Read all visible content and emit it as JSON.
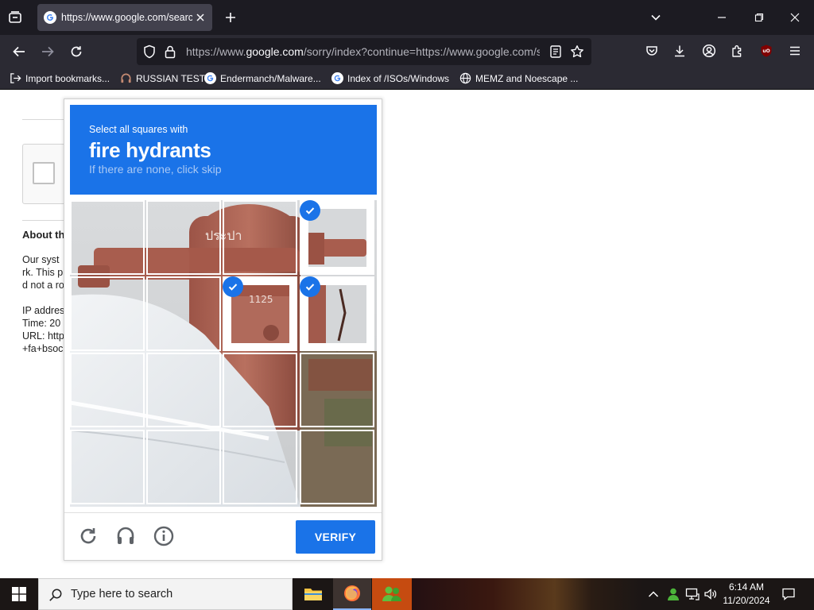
{
  "browser": {
    "tab": {
      "title": "https://www.google.com/search"
    },
    "url": {
      "prefix": "https://www.",
      "host": "google.com",
      "rest": "/sorry/index?continue=https://www.google.com/search"
    },
    "bookmarks": [
      {
        "label": "Import bookmarks...",
        "icon": "import-icon"
      },
      {
        "label": "RUSSIAN TEST",
        "icon": "headset-icon"
      },
      {
        "label": "Endermanch/Malware...",
        "icon": "google-icon"
      },
      {
        "label": "Index of /ISOs/Windows",
        "icon": "google-icon"
      },
      {
        "label": "MEMZ and Noescape ...",
        "icon": "globe-icon"
      }
    ]
  },
  "page": {
    "about_heading": "About th",
    "lines": [
      "Our syst",
      "rk. This p",
      "d not a ro",
      "IP addres",
      "Time: 20",
      "URL: http",
      "+fa+bsoc"
    ]
  },
  "captcha": {
    "instruction": "Select all squares with",
    "target": "fire hydrants",
    "hint": "If there are none, click skip",
    "selected_tiles": [
      3,
      6,
      7
    ],
    "verify_label": "VERIFY",
    "accent": "#1a73e8"
  },
  "taskbar": {
    "search_placeholder": "Type here to search",
    "time": "6:14 AM",
    "date": "11/20/2024"
  }
}
